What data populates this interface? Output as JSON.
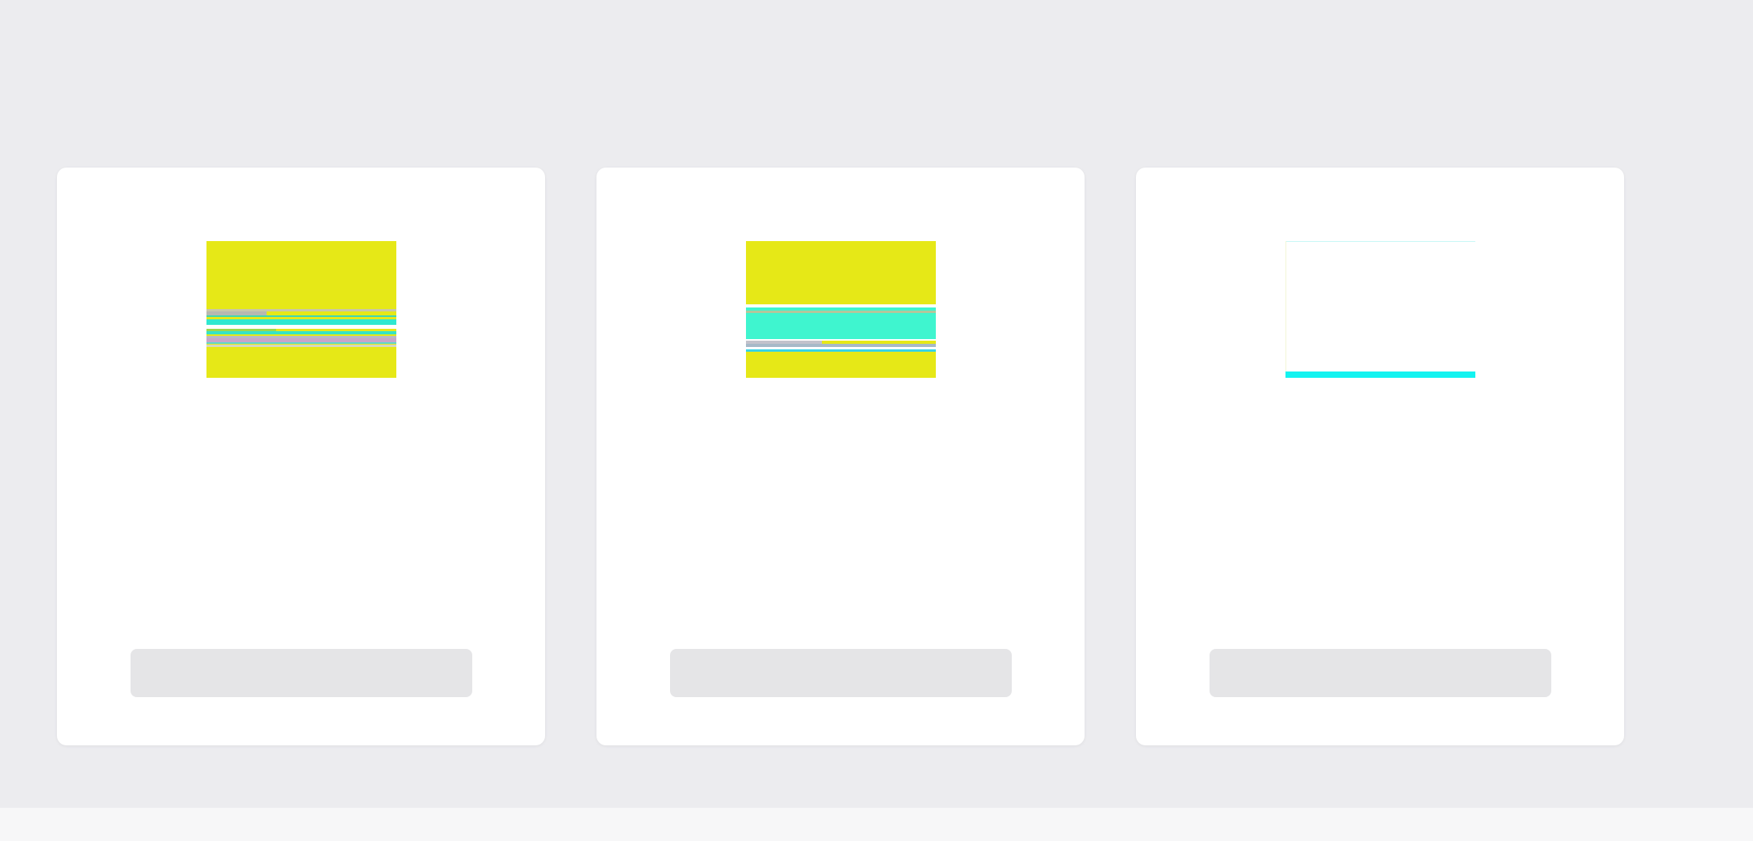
{
  "page": {
    "title": "",
    "background_color": "#ececef",
    "title_color": "#2a2456"
  },
  "cards": [
    {
      "thumbnail_icon": "glitched-thumbnail-image",
      "thumbnail_colors": [
        "#e6e817",
        "#2fe8d0",
        "#ffffff"
      ],
      "title": "",
      "description": "",
      "button_label": ""
    },
    {
      "thumbnail_icon": "glitched-thumbnail-image",
      "thumbnail_colors": [
        "#e6e817",
        "#3ff5cf",
        "#ffffff"
      ],
      "title": "",
      "description": "",
      "button_label": ""
    },
    {
      "thumbnail_icon": "blank-thumbnail-image",
      "thumbnail_colors": [
        "#ffffff",
        "#13f3f0"
      ],
      "title": "",
      "description": "",
      "button_label": ""
    }
  ],
  "colors": {
    "card_background": "#ffffff",
    "button_background": "#e5e5e7",
    "button_text": "#4c4c52",
    "card_title": "#141414",
    "card_text": "#4a4a4f",
    "footer_bar": "#f7f7f8"
  }
}
